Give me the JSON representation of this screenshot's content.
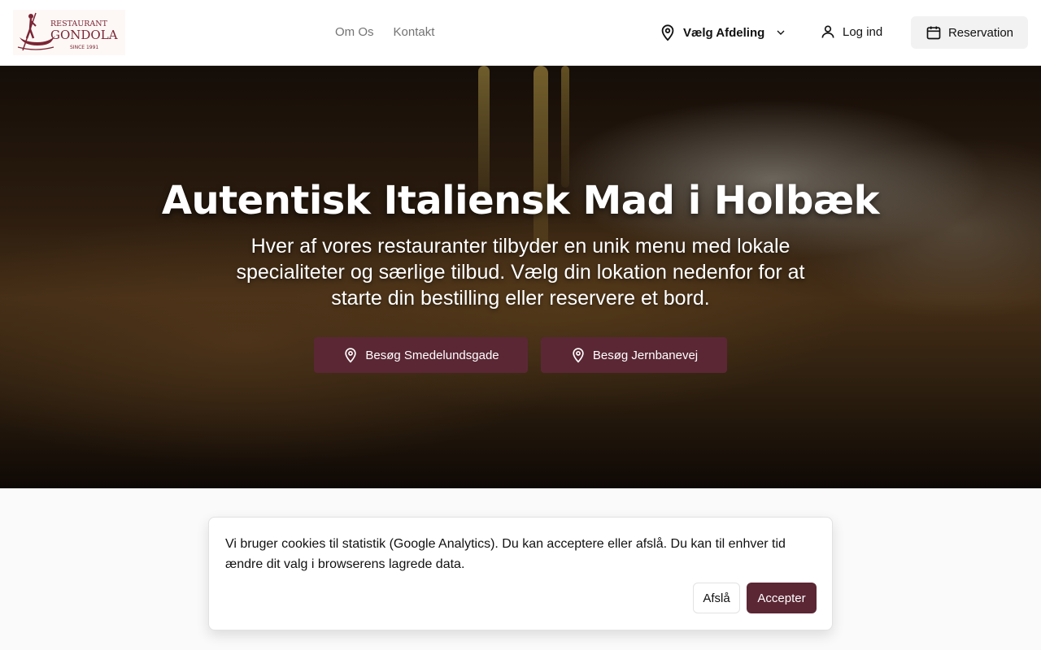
{
  "brand": {
    "line1": "RESTAURANT",
    "line2": "GONDOLA",
    "line3": "SINCE 1991",
    "color": "#7a2434"
  },
  "nav": {
    "items": [
      {
        "label": "Om Os"
      },
      {
        "label": "Kontakt"
      }
    ]
  },
  "header": {
    "department_label": "Vælg Afdeling",
    "login_label": "Log ind",
    "reservation_label": "Reservation"
  },
  "hero": {
    "title": "Autentisk Italiensk Mad i Holbæk",
    "subtitle": "Hver af vores restauranter tilbyder en unik menu med lokale specialiteter og særlige tilbud. Vælg din lokation nedenfor for at starte din bestilling eller reservere et bord.",
    "buttons": [
      {
        "label": "Besøg Smedelundsgade"
      },
      {
        "label": "Besøg Jernbanevej"
      }
    ]
  },
  "cookie": {
    "text": "Vi bruger cookies til statistik (Google Analytics). Du kan acceptere eller afslå. Du kan til enhver tid ændre dit valg i browserens lagrede data.",
    "decline_label": "Afslå",
    "accept_label": "Accepter"
  },
  "colors": {
    "accent": "#5b2735",
    "header_bg": "#ffffff",
    "page_bg": "#fafafa"
  }
}
